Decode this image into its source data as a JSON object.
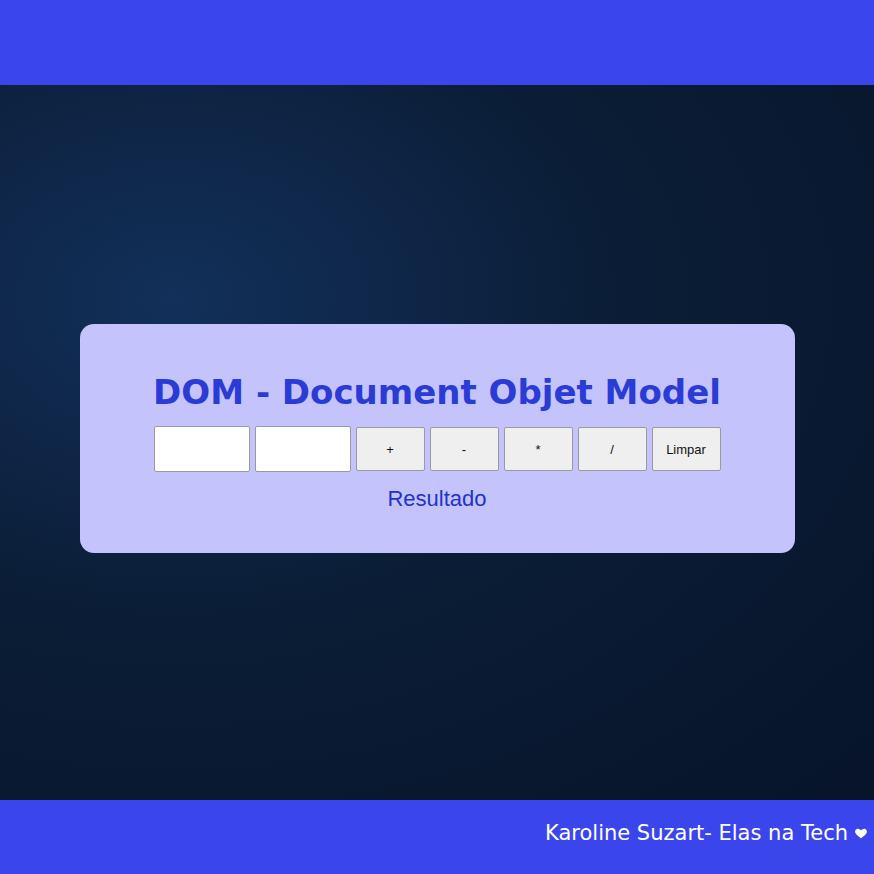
{
  "card": {
    "title": "DOM - Document Objet Model",
    "inputs": [
      {
        "value": ""
      },
      {
        "value": ""
      }
    ],
    "buttons": [
      "+",
      "-",
      "*",
      "/",
      "Limpar"
    ],
    "result": "Resultado"
  },
  "footer": {
    "text": "Karoline Suzart- Elas na Tech"
  }
}
